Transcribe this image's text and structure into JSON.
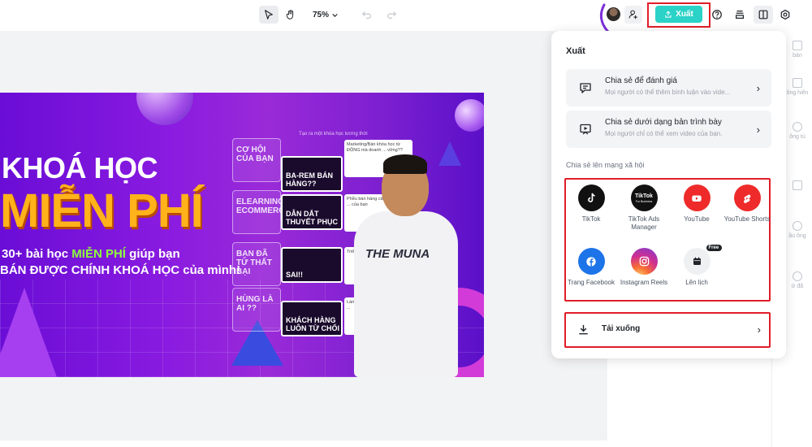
{
  "toolbar": {
    "zoom_label": "75%",
    "export_label": "Xuất"
  },
  "banner": {
    "title_line1": "KHOÁ HỌC",
    "title_line2": "MIỄN PHÍ",
    "subtitle_prefix": "30+ bài học ",
    "subtitle_highlight": "MIỄN PHÍ",
    "subtitle_suffix": " giúp bạn",
    "subtitle_line2": "BÁN ĐƯỢC CHÍNH KHOÁ HỌC của mình!",
    "cards": [
      "BA-REM BÁN HÀNG??",
      "DẪN DẮT THUYẾT PHỤC",
      "SAI!!",
      "KHÁCH HÀNG LUÔN TỪ CHỐI"
    ],
    "tabs": [
      "CƠ HỘI CỦA BẠN",
      "ELEARNING ECOMMERC",
      "BẠN ĐÃ TỪ THẤT BẠI",
      "HÙNG LÀ AI ??"
    ],
    "notes": [
      "Marketing/Bán khóa học từ ĐỘNG mà doanh ... vững??",
      "Phễu bán hàng cách vận dụng ... của bạn",
      "Triển ...",
      "Làm ... bị ..."
    ],
    "shirt_logo": "THE MUNA",
    "top_label": "Tạo ra một khóa học lương thời"
  },
  "panel": {
    "title": "Xuất",
    "share_review_title": "Chia sẻ để đánh giá",
    "share_review_desc": "Mọi người có thể thêm bình luận vào vide...",
    "share_present_title": "Chia sẻ dưới dạng bản trình bày",
    "share_present_desc": "Mọi người chỉ có thể xem video của bạn.",
    "social_label": "Chia sẻ lên mạng xã hội",
    "socials": [
      {
        "label": "TikTok",
        "icon": "tiktok-icon",
        "color": "#111111"
      },
      {
        "label": "TikTok Ads Manager",
        "icon": "tiktok-business-icon",
        "color": "#111111"
      },
      {
        "label": "YouTube",
        "icon": "youtube-icon",
        "color": "#ee2a2a"
      },
      {
        "label": "YouTube Shorts",
        "icon": "youtube-shorts-icon",
        "color": "#ee2a2a"
      },
      {
        "label": "Trang Facebook",
        "icon": "facebook-icon",
        "color": "#1d74e8"
      },
      {
        "label": "Instagram Reels",
        "icon": "instagram-icon",
        "color": "#d02f8f"
      },
      {
        "label": "Lên lịch",
        "icon": "calendar-icon",
        "color": "#eef0f2"
      }
    ],
    "tiktok_business_text": "TikTok",
    "tiktok_business_sub": "For Business",
    "free_badge": "Free",
    "download_label": "Tải xuống"
  },
  "rail": {
    "items": [
      "bản",
      "ông hiển",
      "ông tú",
      "",
      "ầu ông",
      "ử đã"
    ]
  },
  "colors": {
    "accent": "#2bd2c7",
    "highlight_border": "#e11d2a",
    "arrow": "#7b2fd6"
  }
}
